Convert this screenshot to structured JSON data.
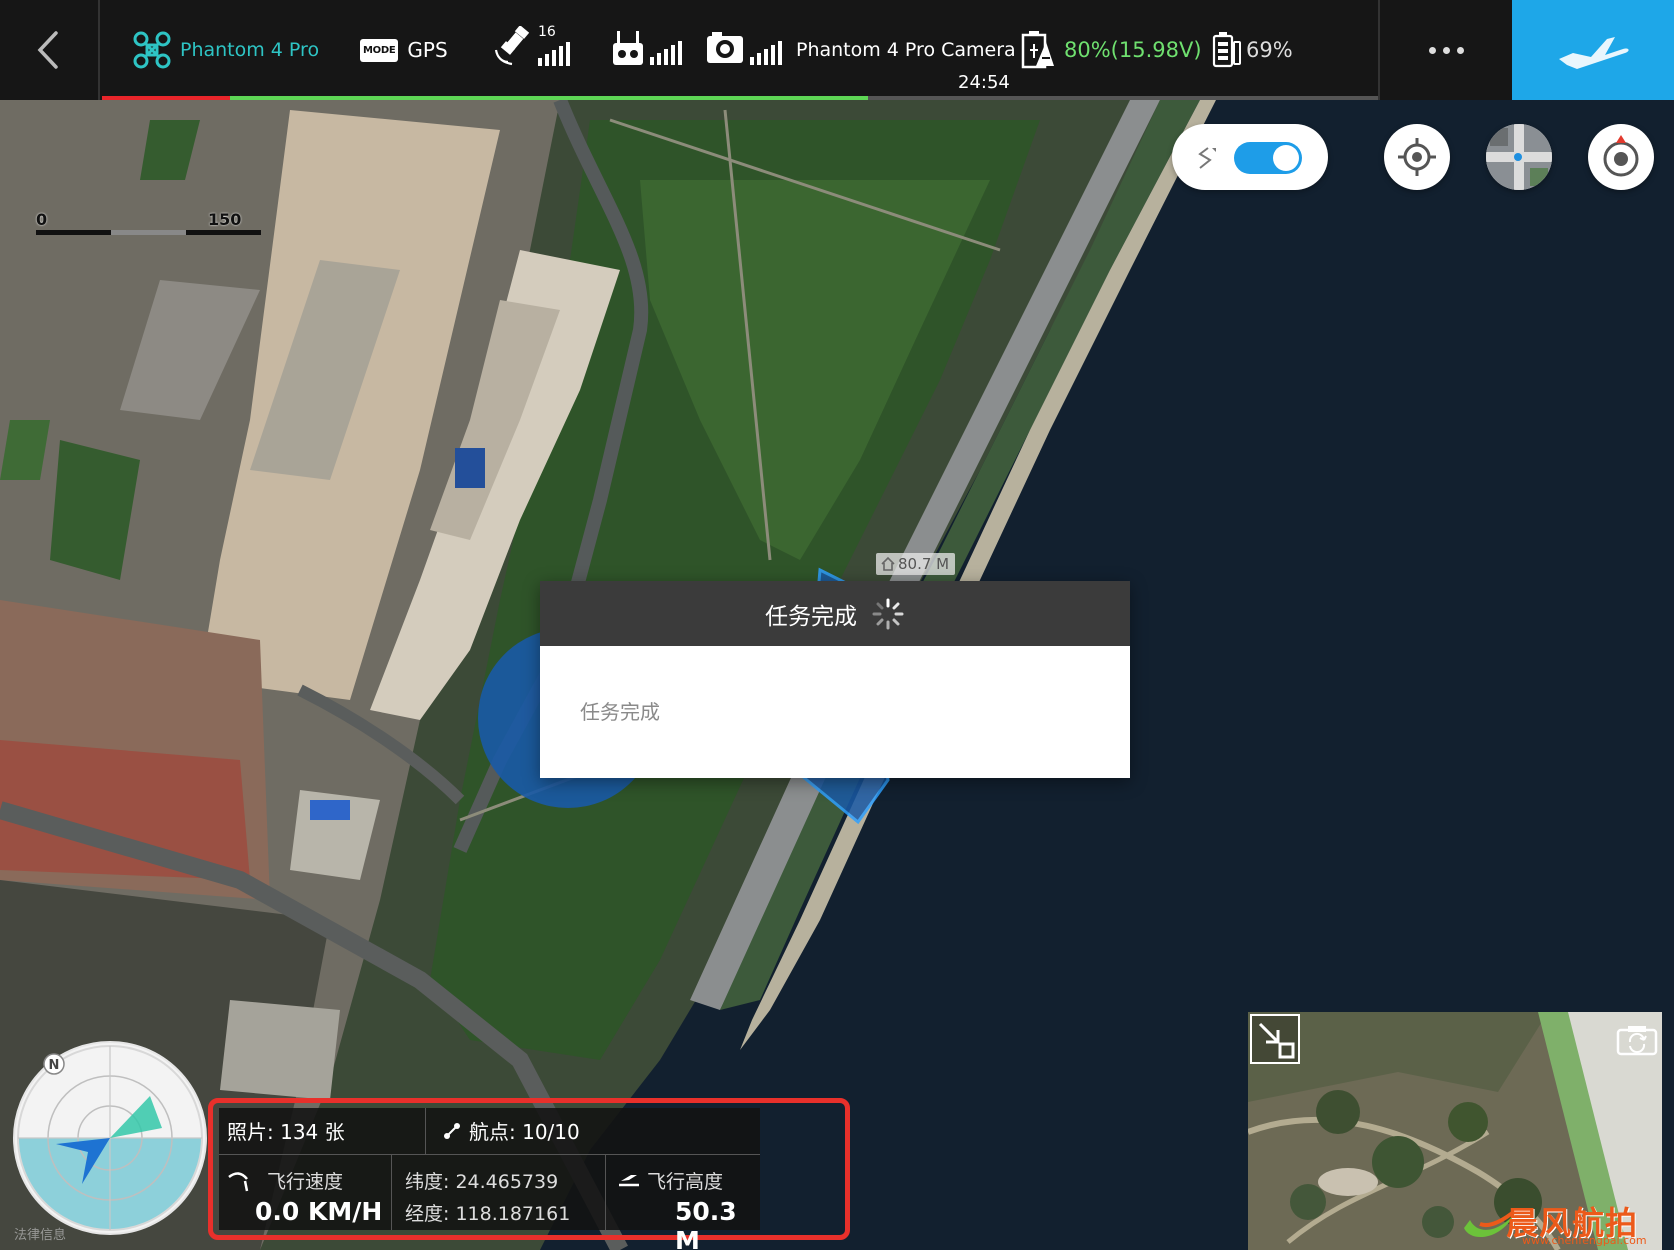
{
  "topbar": {
    "aircraft_name": "Phantom 4 Pro",
    "mode_badge": "MODE",
    "mode": "GPS",
    "satellite_count": "16",
    "camera_name": "Phantom 4 Pro Camera",
    "battery": "80%(15.98V)",
    "flight_time": "24:54",
    "device_battery": "69%",
    "mission_progress": 0.6,
    "icons": {
      "back": "chevron-left-icon",
      "aircraft": "drone-icon",
      "satellite": "satellite-icon",
      "remote": "remote-controller-icon",
      "camera": "camera-icon",
      "battery": "aircraft-battery-icon",
      "device_battery": "device-battery-icon",
      "more": "more-icon",
      "fly": "airplane-icon"
    },
    "colors": {
      "accent": "#1ea7e8",
      "aircraft": "#2ec4c4",
      "battery": "#6fe06f",
      "alert": "#e8252a"
    }
  },
  "map": {
    "scale_start": "0",
    "scale_end": "150",
    "home_altitude": "80.7 M",
    "route_toggle_on": true
  },
  "dialog": {
    "title": "任务完成",
    "message": "任务完成"
  },
  "compass": {
    "north": "N"
  },
  "telemetry": {
    "photos": "照片: 134 张",
    "waypoints": "航点: 10/10",
    "speed_label": "飞行速度",
    "speed_value": "0.0 KM/H",
    "latitude": "纬度: 24.465739",
    "longitude": "经度: 118.187161",
    "altitude_label": "飞行高度",
    "altitude_value": "50.3 M"
  },
  "camera_view": {
    "expand_icon": "collapse-arrow-icon",
    "switch_icon": "camera-switch-icon"
  },
  "watermark": {
    "brand": "晨风航拍",
    "url": "www.chenfengpai.com"
  },
  "corner_text": "法律信息"
}
